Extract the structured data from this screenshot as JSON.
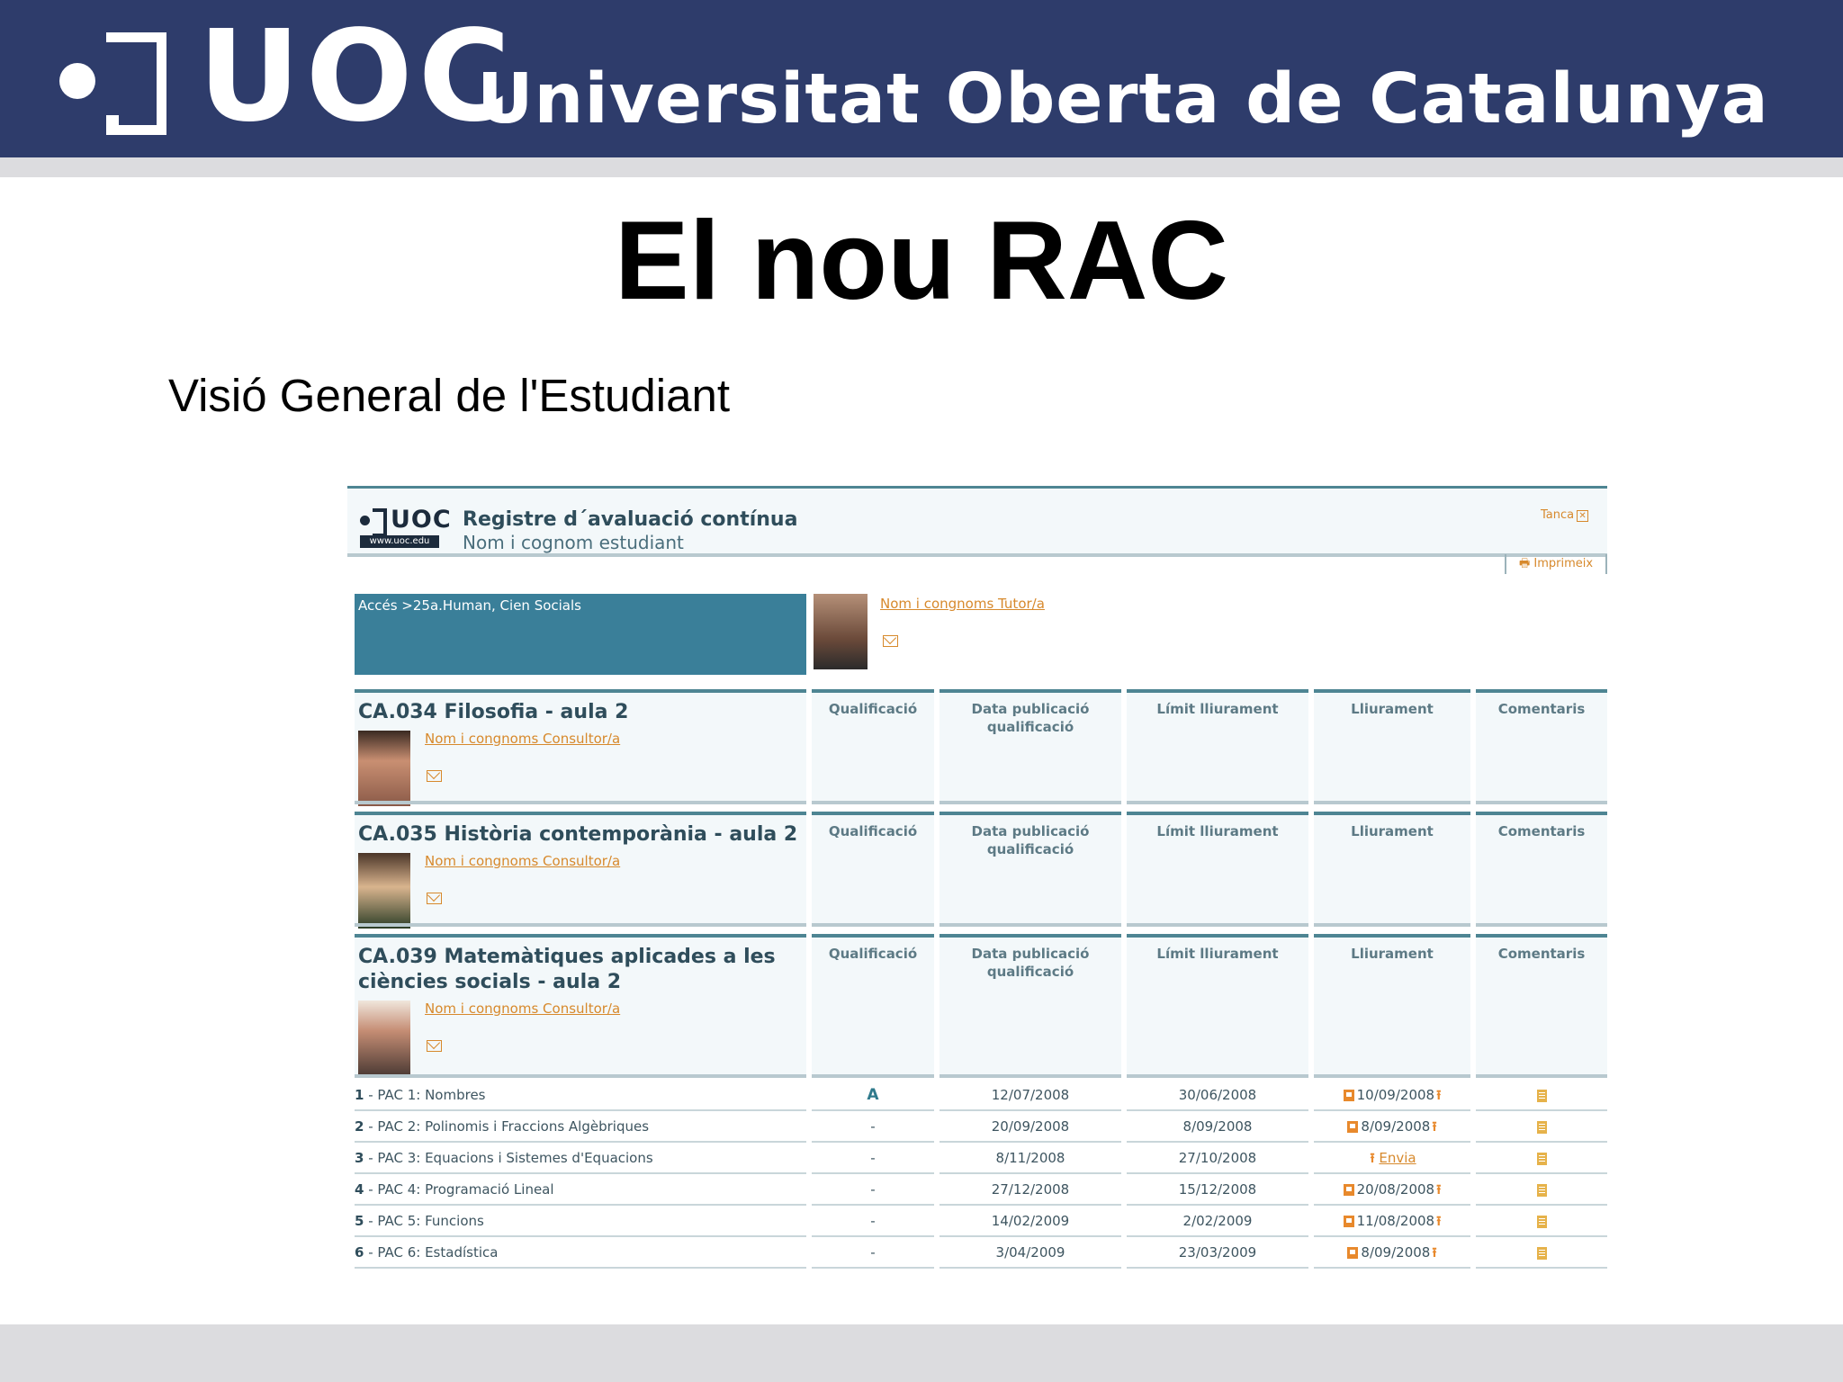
{
  "banner": {
    "logo_text": "UOC",
    "title": "Universitat Oberta de Catalunya"
  },
  "slide": {
    "title": "El nou RAC",
    "subtitle": "Visió General de l'Estudiant"
  },
  "rac": {
    "logo_text": "UOC",
    "logo_url": "www.uoc.edu",
    "title": "Registre d´avaluació contínua",
    "student": "Nom i cognom estudiant",
    "close_label": "Tanca",
    "print_label": "Imprimeix",
    "access_label": "Accés >25a.Human, Cien Socials",
    "tutor_link": "Nom i congnoms Tutor/a",
    "columns": [
      "Qualificació",
      "Data publicació qualificació",
      "Límit lliurament",
      "Lliurament",
      "Comentaris"
    ],
    "courses": [
      {
        "title": "CA.034 Filosofia - aula 2",
        "consultor": "Nom i congnoms Consultor/a"
      },
      {
        "title": "CA.035 Història contemporània - aula 2",
        "consultor": "Nom i congnoms Consultor/a"
      },
      {
        "title": "CA.039 Matemàtiques aplicades a les ciències socials - aula 2",
        "consultor": "Nom i congnoms Consultor/a"
      }
    ],
    "pacs": [
      {
        "num": "1",
        "name": " - PAC 1: Nombres",
        "grade": "A",
        "published": "12/07/2008",
        "limit": "30/06/2008",
        "delivery": "10/09/2008"
      },
      {
        "num": "2",
        "name": " - PAC 2: Polinomis i Fraccions Algèbriques",
        "grade": "-",
        "published": "20/09/2008",
        "limit": "8/09/2008",
        "delivery": "8/09/2008"
      },
      {
        "num": "3",
        "name": " - PAC 3: Equacions i Sistemes d'Equacions",
        "grade": "-",
        "published": "8/11/2008",
        "limit": "27/10/2008",
        "delivery": "Envia"
      },
      {
        "num": "4",
        "name": " - PAC 4: Programació Lineal",
        "grade": "-",
        "published": "27/12/2008",
        "limit": "15/12/2008",
        "delivery": "20/08/2008"
      },
      {
        "num": "5",
        "name": " - PAC 5: Funcions",
        "grade": "-",
        "published": "14/02/2009",
        "limit": "2/02/2009",
        "delivery": "11/08/2008"
      },
      {
        "num": "6",
        "name": " - PAC 6: Estadística",
        "grade": "-",
        "published": "3/04/2009",
        "limit": "23/03/2009",
        "delivery": "8/09/2008"
      }
    ]
  },
  "colors": {
    "banner": "#2e3c6b",
    "accent_teal": "#4e8593",
    "access_box": "#3a7f99",
    "link_orange": "#d7892c",
    "late_red": "#d0443b"
  }
}
